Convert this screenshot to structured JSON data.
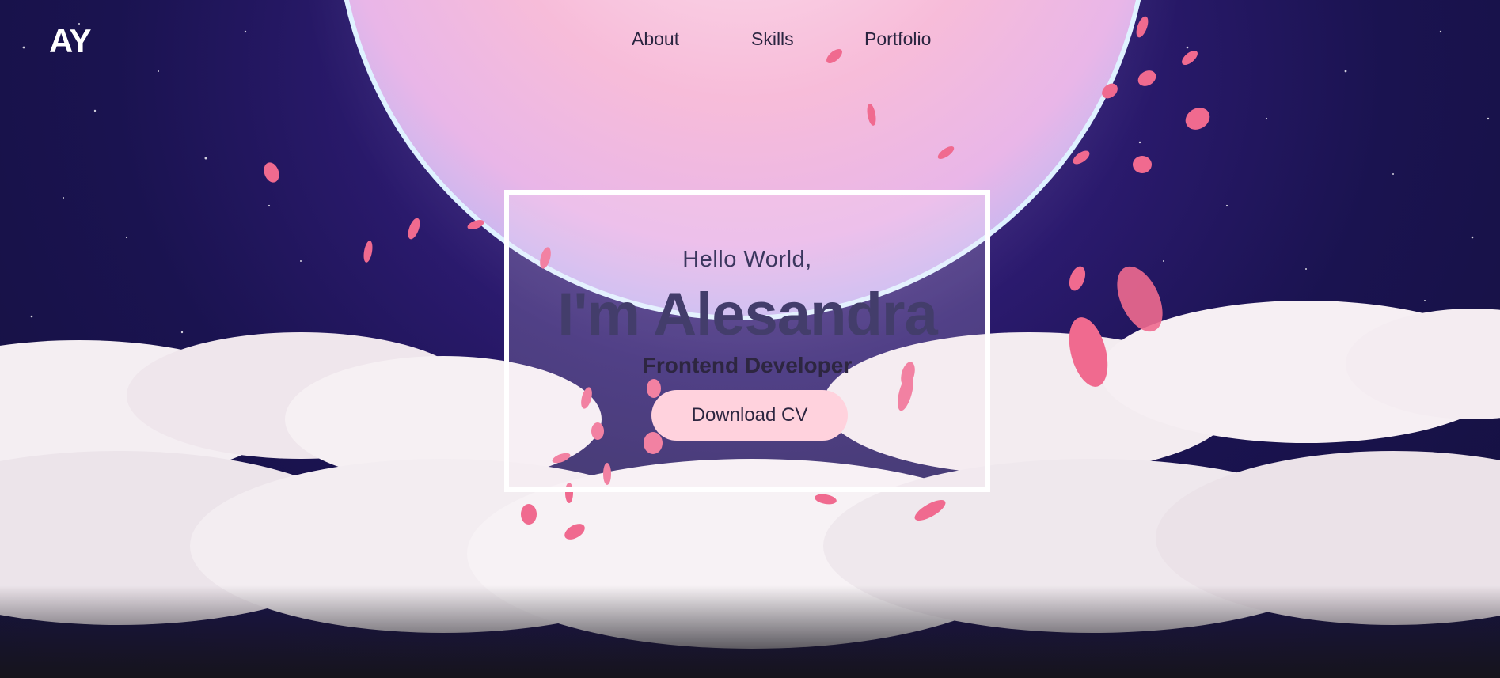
{
  "header": {
    "logo": "AY",
    "nav": [
      {
        "label": "About"
      },
      {
        "label": "Skills"
      },
      {
        "label": "Portfolio"
      }
    ]
  },
  "hero": {
    "greeting": "Hello World,",
    "name": "I'm Alesandra",
    "role": "Frontend Developer",
    "cta_label": "Download CV"
  },
  "colors": {
    "sky": "#1a1350",
    "moon": "#f7c3dc",
    "petal": "#f06a8f",
    "button": "#ffd2dd",
    "text_dark": "#433d6b"
  }
}
